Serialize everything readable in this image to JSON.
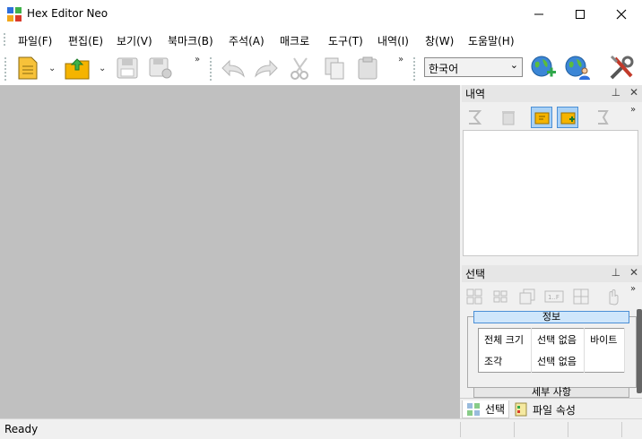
{
  "window": {
    "title": "Hex Editor Neo",
    "controls": [
      "minimize",
      "maximize",
      "close"
    ]
  },
  "menu": [
    "파일(F)",
    "편집(E)",
    "보기(V)",
    "북마크(B)",
    "주석(A)",
    "매크로",
    "도구(T)",
    "내역(I)",
    "창(W)",
    "도움말(H)"
  ],
  "toolbar": {
    "buttons": [
      "new-file",
      "open-file",
      "save",
      "save-all",
      "undo",
      "redo",
      "cut",
      "copy",
      "paste",
      "web-add",
      "web-user",
      "settings"
    ],
    "language": "한국어"
  },
  "history_panel": {
    "title": "내역",
    "tools": [
      "sum",
      "trash",
      "history-back",
      "history-add",
      "export"
    ]
  },
  "selection_panel": {
    "title": "선택",
    "tools": [
      "grid-1",
      "grid-2",
      "grid-3",
      "hex-1F",
      "grid-4",
      "hand"
    ],
    "info_header": "정보",
    "table": [
      [
        "전체 크기",
        "선택 없음",
        "바이트"
      ],
      [
        "조각",
        "선택 없음",
        ""
      ]
    ],
    "details_label": "세부 사항"
  },
  "bottom_tabs": [
    "선택",
    "파일 속성"
  ],
  "status": "Ready",
  "colors": {
    "workspace": "#c0c0c0",
    "accent": "#4b8fd6",
    "folder": "#f5b400"
  }
}
